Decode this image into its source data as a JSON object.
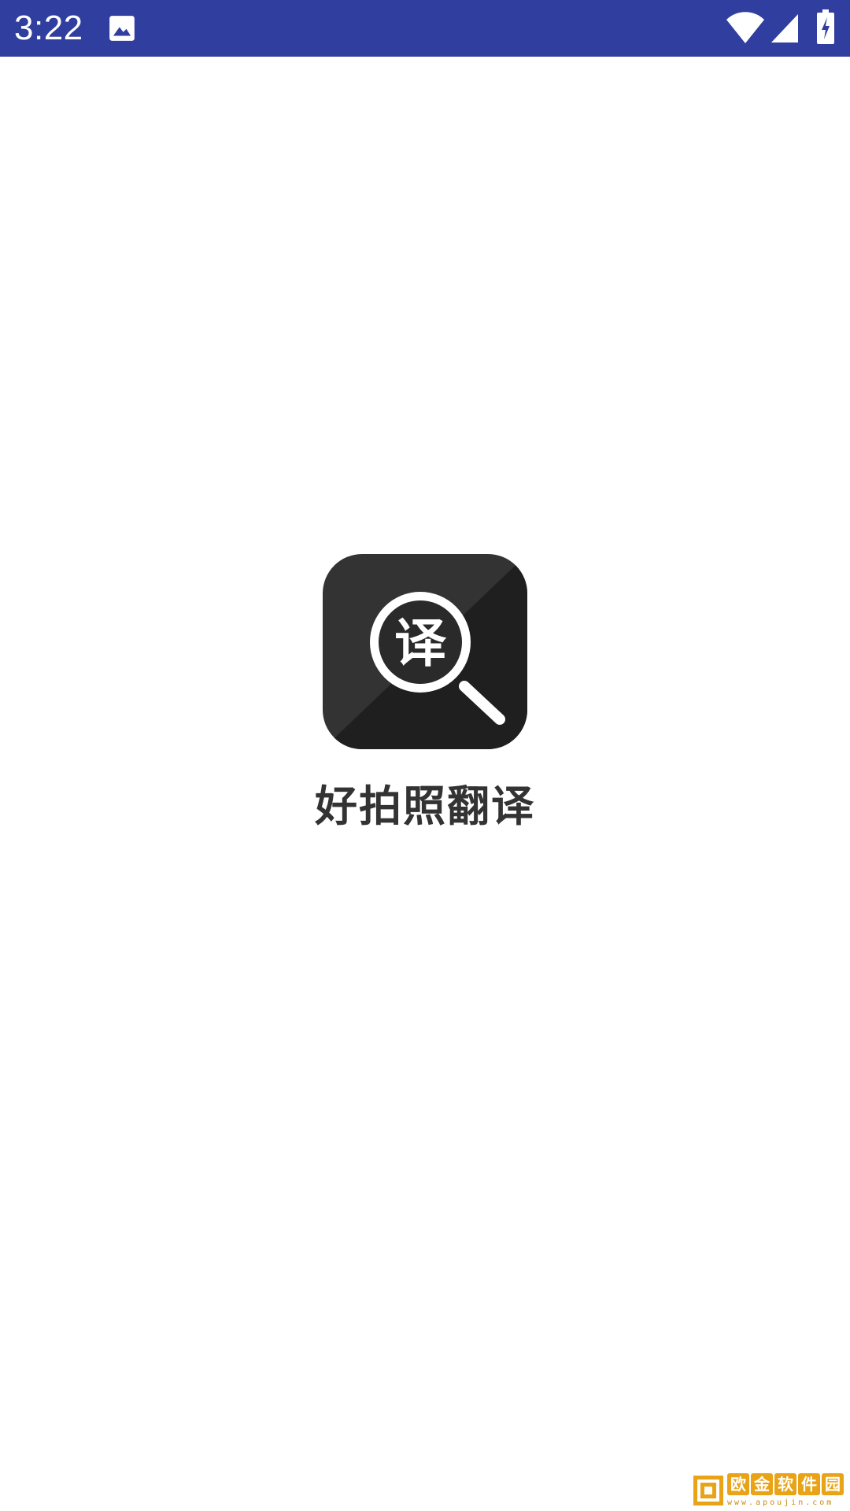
{
  "status_bar": {
    "time": "3:22",
    "background_color": "#303F9F",
    "icons": [
      "image-icon",
      "wifi-icon",
      "cell-signal-icon",
      "battery-charging-icon"
    ]
  },
  "splash": {
    "logo_glyph": "译",
    "logo_icon": "magnifier-translate-icon",
    "app_name": "好拍照翻译"
  },
  "watermark": {
    "chars": [
      "欧",
      "金",
      "软",
      "件",
      "园"
    ],
    "url": "www.apoujin.com",
    "color": "#E8A317"
  }
}
